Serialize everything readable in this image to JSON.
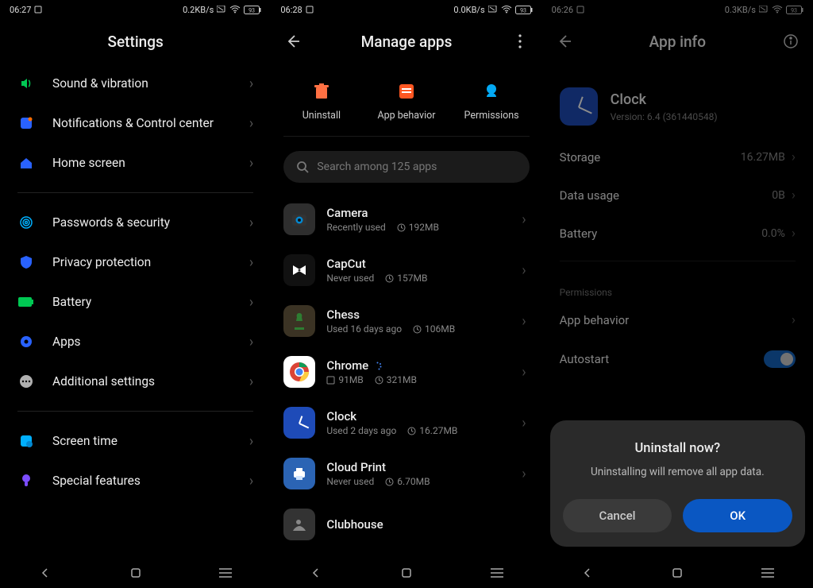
{
  "pane1": {
    "status": {
      "time": "06:27",
      "rate": "0.2KB/s",
      "battery": "93"
    },
    "title": "Settings",
    "items": [
      {
        "label": "Sound & vibration",
        "icon": "volume",
        "color": "ic-green"
      },
      {
        "label": "Notifications & Control center",
        "icon": "bell",
        "color": "ic-blue"
      },
      {
        "label": "Home screen",
        "icon": "home",
        "color": "ic-blue"
      }
    ],
    "items2": [
      {
        "label": "Passwords & security",
        "icon": "fingerprint",
        "color": "ic-cyan"
      },
      {
        "label": "Privacy protection",
        "icon": "shield",
        "color": "ic-blue"
      },
      {
        "label": "Battery",
        "icon": "battery",
        "color": "ic-green"
      },
      {
        "label": "Apps",
        "icon": "gear",
        "color": "ic-blue"
      },
      {
        "label": "Additional settings",
        "icon": "dots",
        "color": "ic-grey"
      }
    ],
    "items3": [
      {
        "label": "Screen time",
        "icon": "hourglass",
        "color": "ic-cyan"
      },
      {
        "label": "Special features",
        "icon": "wand",
        "color": "ic-purple"
      }
    ]
  },
  "pane2": {
    "status": {
      "time": "06:28",
      "rate": "0.0KB/s",
      "battery": "93"
    },
    "title": "Manage apps",
    "actions": {
      "uninstall": "Uninstall",
      "behavior": "App behavior",
      "permissions": "Permissions"
    },
    "search_placeholder": "Search among 125 apps",
    "apps": [
      {
        "name": "Camera",
        "sub": "Recently used",
        "size": "192MB",
        "bg": "#2e2e2e",
        "glyph": "camera"
      },
      {
        "name": "CapCut",
        "sub": "Never used",
        "size": "157MB",
        "bg": "#111",
        "glyph": "capcut"
      },
      {
        "name": "Chess",
        "sub": "Used 16 days ago",
        "size": "106MB",
        "bg": "#3b3324",
        "glyph": "chess"
      },
      {
        "name": "Chrome",
        "sub": "91MB",
        "size": "321MB",
        "bg": "#fff",
        "glyph": "chrome",
        "badge": true,
        "sub_is_size": true
      },
      {
        "name": "Clock",
        "sub": "Used 2 days ago",
        "size": "16.27MB",
        "bg": "#1e4bb8",
        "glyph": "clock"
      },
      {
        "name": "Cloud Print",
        "sub": "Never used",
        "size": "6.70MB",
        "bg": "#2b64b4",
        "glyph": "print"
      },
      {
        "name": "Clubhouse",
        "sub": "",
        "size": "",
        "bg": "#333",
        "glyph": "club"
      }
    ]
  },
  "pane3": {
    "status": {
      "time": "06:26",
      "rate": "0.3KB/s",
      "battery": "93"
    },
    "title": "App info",
    "app": {
      "name": "Clock",
      "version": "Version: 6.4 (361440548)"
    },
    "rows": {
      "storage": {
        "label": "Storage",
        "value": "16.27MB"
      },
      "datausage": {
        "label": "Data usage",
        "value": "0B"
      },
      "battery": {
        "label": "Battery",
        "value": "0.0%"
      }
    },
    "perm_tag": "Permissions",
    "behavior": "App behavior",
    "autostart": "Autostart",
    "dialog": {
      "title": "Uninstall now?",
      "message": "Uninstalling will remove all app data.",
      "cancel": "Cancel",
      "ok": "OK"
    }
  }
}
